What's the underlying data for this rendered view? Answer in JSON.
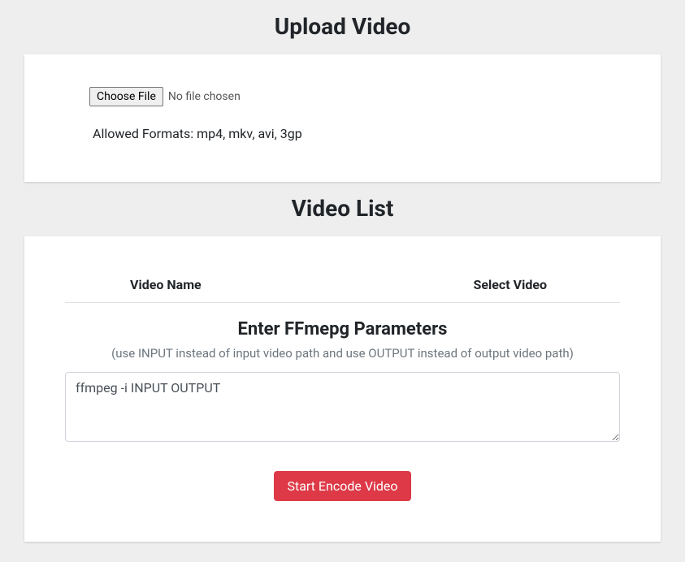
{
  "upload": {
    "title": "Upload Video",
    "choose_file_label": "Choose File",
    "file_status": "No file chosen",
    "allowed_formats": "Allowed Formats: mp4, mkv, avi, 3gp"
  },
  "video_list": {
    "title": "Video List",
    "columns": {
      "name": "Video Name",
      "select": "Select Video"
    },
    "params_title": "Enter FFmepg Parameters",
    "params_hint": "(use INPUT instead of input video path and use OUTPUT instead of output video path)",
    "params_value": "ffmpeg -i INPUT OUTPUT",
    "start_button": "Start Encode Video"
  }
}
